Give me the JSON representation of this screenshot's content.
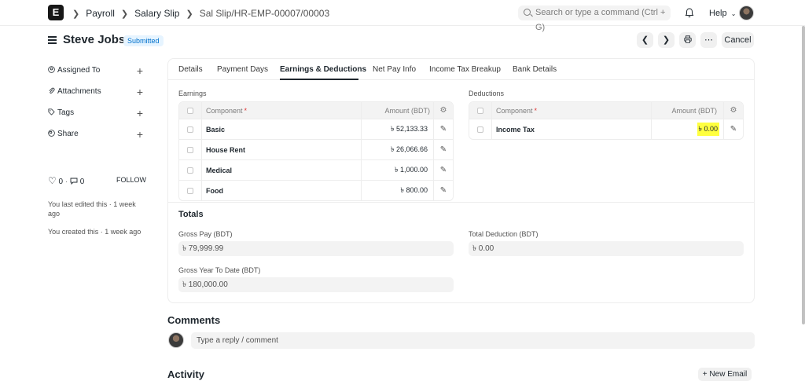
{
  "navbar": {
    "logo": "E",
    "breadcrumbs": [
      "Payroll",
      "Salary Slip",
      "Sal Slip/HR-EMP-00007/00003"
    ],
    "search_placeholder": "Search or type a command (Ctrl + G)",
    "help_label": "Help"
  },
  "page": {
    "title": "Steve Jobs",
    "status": "Submitted",
    "cancel_label": "Cancel"
  },
  "sidebar": {
    "items": [
      {
        "label": "Assigned To",
        "icon": "user-assign-icon"
      },
      {
        "label": "Attachments",
        "icon": "paperclip-icon"
      },
      {
        "label": "Tags",
        "icon": "tag-icon"
      },
      {
        "label": "Share",
        "icon": "share-icon"
      }
    ],
    "likes": "0",
    "comments_count": "0",
    "follow_label": "FOLLOW",
    "last_edited": "You last edited this · 1 week ago",
    "created": "You created this · 1 week ago"
  },
  "tabs": [
    "Details",
    "Payment Days",
    "Earnings & Deductions",
    "Net Pay Info",
    "Income Tax Breakup",
    "Bank Details"
  ],
  "active_tab": "Earnings & Deductions",
  "earnings": {
    "label": "Earnings",
    "col_component": "Component",
    "col_amount": "Amount (BDT)",
    "rows": [
      {
        "component": "Basic",
        "amount": "৳ 52,133.33"
      },
      {
        "component": "House Rent",
        "amount": "৳ 26,066.66"
      },
      {
        "component": "Medical",
        "amount": "৳ 1,000.00"
      },
      {
        "component": "Food",
        "amount": "৳ 800.00"
      }
    ]
  },
  "deductions": {
    "label": "Deductions",
    "col_component": "Component",
    "col_amount": "Amount (BDT)",
    "rows": [
      {
        "component": "Income Tax",
        "amount": "৳ 0.00"
      }
    ]
  },
  "totals": {
    "heading": "Totals",
    "gross_pay_label": "Gross Pay (BDT)",
    "gross_pay": "৳ 79,999.99",
    "total_deduction_label": "Total Deduction (BDT)",
    "total_deduction": "৳ 0.00",
    "gross_ytd_label": "Gross Year To Date (BDT)",
    "gross_ytd": "৳ 180,000.00"
  },
  "comments": {
    "heading": "Comments",
    "placeholder": "Type a reply / comment"
  },
  "activity": {
    "heading": "Activity",
    "new_email_label": "+ New Email"
  },
  "colors": {
    "status_badge_bg": "#e6f4ff",
    "status_badge_text": "#0070cc",
    "highlight": "#ffff3f"
  }
}
